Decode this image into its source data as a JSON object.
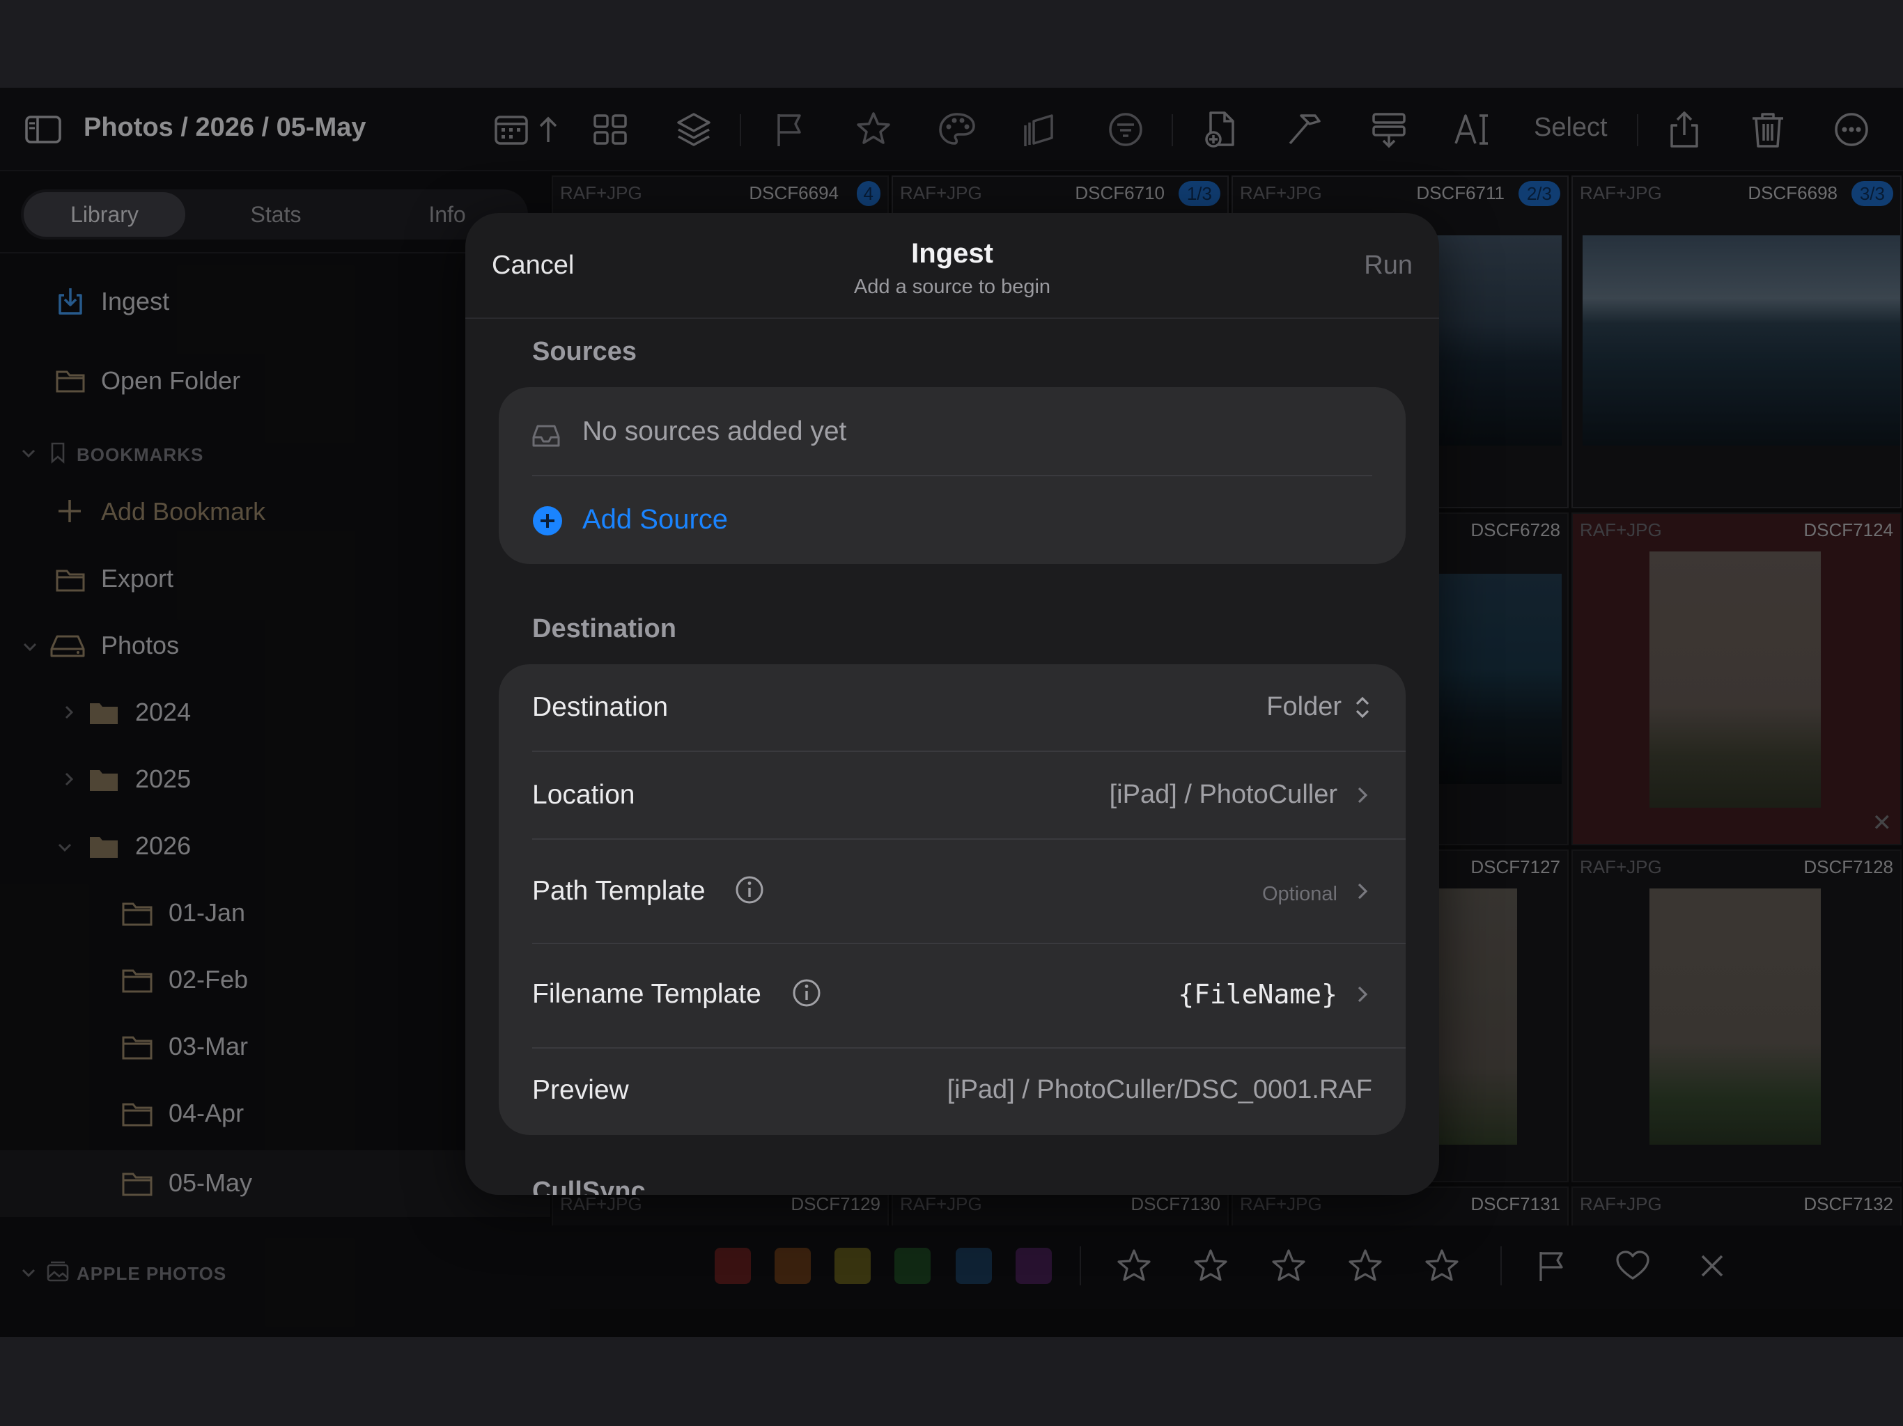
{
  "toolbar": {
    "breadcrumb": "Photos / 2026 / 05-May",
    "select_label": "Select",
    "icons": [
      "sidebar-toggle-icon",
      "calendar-icon",
      "sort-arrow-icon",
      "grid-icon",
      "layers-icon",
      "flag-icon",
      "star-icon",
      "palette-icon",
      "stack-icon",
      "filter-icon",
      "import-file-icon",
      "hammer-icon",
      "metadata-icon",
      "text-icon",
      "share-icon",
      "trash-icon",
      "more-icon"
    ]
  },
  "sidebar": {
    "tabs": [
      {
        "label": "Library"
      },
      {
        "label": "Stats"
      },
      {
        "label": "Info"
      }
    ],
    "items": {
      "ingest": "Ingest",
      "open_folder": "Open Folder",
      "bookmarks_header": "BOOKMARKS",
      "add_bookmark": "Add Bookmark",
      "export": "Export",
      "photos": "Photos",
      "y2024": "2024",
      "y2025": "2025",
      "y2026": "2026",
      "jan": "01-Jan",
      "feb": "02-Feb",
      "mar": "03-Mar",
      "apr": "04-Apr",
      "may": "05-May",
      "apple_header": "APPLE PHOTOS"
    }
  },
  "grid": {
    "row1": [
      {
        "tag": "RAF+JPG",
        "name": "DSCF6694",
        "badge": "4"
      },
      {
        "tag": "RAF+JPG",
        "name": "DSCF6710",
        "badge": "1/3"
      },
      {
        "tag": "RAF+JPG",
        "name": "DSCF6711",
        "badge": "2/3"
      },
      {
        "tag": "RAF+JPG",
        "name": "DSCF6698",
        "badge": "3/3"
      }
    ],
    "row2": [
      {
        "name": "DSCF6728"
      },
      {
        "tag": "RAF+JPG",
        "name": "DSCF7124"
      }
    ],
    "row3": [
      {
        "name": "DSCF7127"
      },
      {
        "tag": "RAF+JPG",
        "name": "DSCF7128"
      }
    ],
    "row4": [
      {
        "tag": "RAF+JPG",
        "name": "DSCF7129"
      },
      {
        "tag": "RAF+JPG",
        "name": "DSCF7130"
      },
      {
        "tag": "RAF+JPG",
        "name": "DSCF7131"
      },
      {
        "tag": "RAF+JPG",
        "name": "DSCF7132"
      }
    ]
  },
  "filterbar": {
    "colors": [
      "#5a1c1c",
      "#5a3416",
      "#57501a",
      "#1b4020",
      "#173550",
      "#3e1c4a"
    ]
  },
  "modal": {
    "cancel": "Cancel",
    "title": "Ingest",
    "subtitle": "Add a source to begin",
    "run": "Run",
    "sources_title": "Sources",
    "no_sources": "No sources added yet",
    "add_source": "Add Source",
    "destination_title": "Destination",
    "rows": {
      "destination_label": "Destination",
      "destination_value": "Folder",
      "location_label": "Location",
      "location_value": "[iPad] / PhotoCuller",
      "path_label": "Path Template",
      "path_value": "Optional",
      "filename_label": "Filename Template",
      "filename_value": "{FileName}",
      "preview_label": "Preview",
      "preview_value": "[iPad] / PhotoCuller/DSC_0001.RAF"
    },
    "next_section": "CullSync",
    "accent": "#1a84ff"
  }
}
